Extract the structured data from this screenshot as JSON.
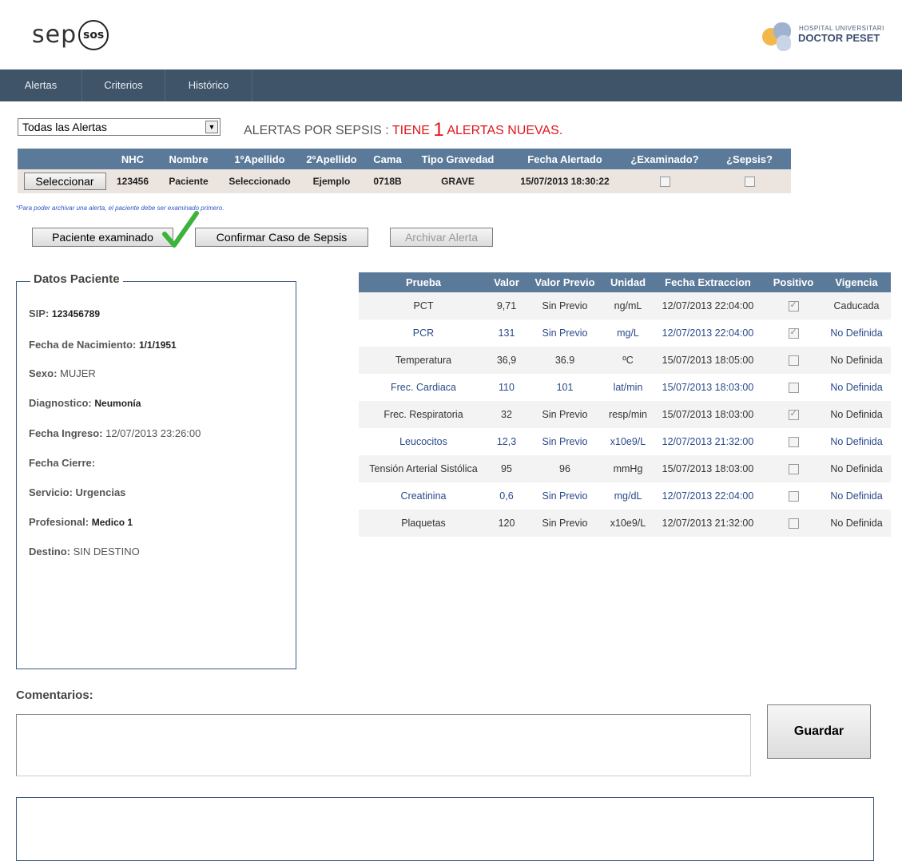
{
  "header": {
    "logo_left_text": "sep",
    "logo_left_badge": "sos",
    "logo_right_line1": "HOSPITAL UNIVERSITARI",
    "logo_right_line2": "DOCTOR PESET"
  },
  "nav": {
    "items": [
      {
        "label": "Alertas"
      },
      {
        "label": "Criterios"
      },
      {
        "label": "Histórico"
      }
    ]
  },
  "alerts": {
    "filter_value": "Todas las Alertas",
    "title_prefix": "ALERTAS POR SEPSIS : ",
    "title_mid": "TIENE ",
    "title_count": "1",
    "title_suffix": " ALERTAS NUEVAS.",
    "columns": [
      "",
      "NHC",
      "Nombre",
      "1ºApellido",
      "2ºApellido",
      "Cama",
      "Tipo Gravedad",
      "Fecha Alertado",
      "¿Examinado?",
      "¿Sepsis?"
    ],
    "row": {
      "select_label": "Seleccionar",
      "nhc": "123456",
      "nombre": "Paciente",
      "apellido1": "Seleccionado",
      "apellido2": "Ejemplo",
      "cama": "0718B",
      "gravedad": "GRAVE",
      "fecha": "15/07/2013 18:30:22",
      "examinado": false,
      "sepsis": false
    },
    "note": "*Para poder archivar una alerta, el paciente debe ser examinado primero."
  },
  "actions": {
    "examinado_label": "Paciente examinado",
    "confirmar_label": "Confirmar Caso de Sepsis",
    "archivar_label": "Archivar Alerta"
  },
  "patient": {
    "legend": "Datos Paciente",
    "sip_label": "SIP:",
    "sip": "123456789",
    "nacimiento_label": "Fecha de Nacimiento:",
    "nacimiento": "1/1/1951",
    "sexo_label": "Sexo:",
    "sexo": "MUJER",
    "diagnostico_label": "Diagnostico:",
    "diagnostico": "Neumonía",
    "ingreso_label": "Fecha Ingreso:",
    "ingreso": "12/07/2013 23:26:00",
    "cierre_label": "Fecha Cierre:",
    "cierre": "",
    "servicio_label": "Servicio:",
    "servicio": "Urgencias",
    "profesional_label": "Profesional:",
    "profesional": "Medico 1",
    "destino_label": "Destino:",
    "destino": "SIN DESTINO"
  },
  "labs": {
    "columns": [
      "Prueba",
      "Valor",
      "Valor Previo",
      "Unidad",
      "Fecha Extraccion",
      "Positivo",
      "Vigencia"
    ],
    "rows": [
      {
        "prueba": "PCT",
        "valor": "9,71",
        "previo": "Sin Previo",
        "unidad": "ng/mL",
        "fecha": "12/07/2013 22:04:00",
        "positivo": true,
        "vigencia": "Caducada"
      },
      {
        "prueba": "PCR",
        "valor": "131",
        "previo": "Sin Previo",
        "unidad": "mg/L",
        "fecha": "12/07/2013 22:04:00",
        "positivo": true,
        "vigencia": "No Definida"
      },
      {
        "prueba": "Temperatura",
        "valor": "36,9",
        "previo": "36.9",
        "unidad": "ºC",
        "fecha": "15/07/2013 18:05:00",
        "positivo": false,
        "vigencia": "No Definida"
      },
      {
        "prueba": "Frec. Cardiaca",
        "valor": "110",
        "previo": "101",
        "unidad": "lat/min",
        "fecha": "15/07/2013 18:03:00",
        "positivo": false,
        "vigencia": "No Definida"
      },
      {
        "prueba": "Frec. Respiratoria",
        "valor": "32",
        "previo": "Sin Previo",
        "unidad": "resp/min",
        "fecha": "15/07/2013 18:03:00",
        "positivo": true,
        "vigencia": "No Definida"
      },
      {
        "prueba": "Leucocitos",
        "valor": "12,3",
        "previo": "Sin Previo",
        "unidad": "x10e9/L",
        "fecha": "12/07/2013 21:32:00",
        "positivo": false,
        "vigencia": "No Definida"
      },
      {
        "prueba": "Tensión Arterial Sistólica",
        "valor": "95",
        "previo": "96",
        "unidad": "mmHg",
        "fecha": "15/07/2013 18:03:00",
        "positivo": false,
        "vigencia": "No Definida"
      },
      {
        "prueba": "Creatinina",
        "valor": "0,6",
        "previo": "Sin Previo",
        "unidad": "mg/dL",
        "fecha": "12/07/2013 22:04:00",
        "positivo": false,
        "vigencia": "No Definida"
      },
      {
        "prueba": "Plaquetas",
        "valor": "120",
        "previo": "Sin Previo",
        "unidad": "x10e9/L",
        "fecha": "12/07/2013 21:32:00",
        "positivo": false,
        "vigencia": "No Definida"
      }
    ]
  },
  "comments": {
    "label": "Comentarios:",
    "input_value": "",
    "save_label": "Guardar"
  },
  "colors": {
    "nav_bg": "#3f5369",
    "table_header": "#5b7a9a",
    "alert_red": "#e0161b",
    "link_blue": "#2a4a8a",
    "check_green": "#3cb43c"
  }
}
